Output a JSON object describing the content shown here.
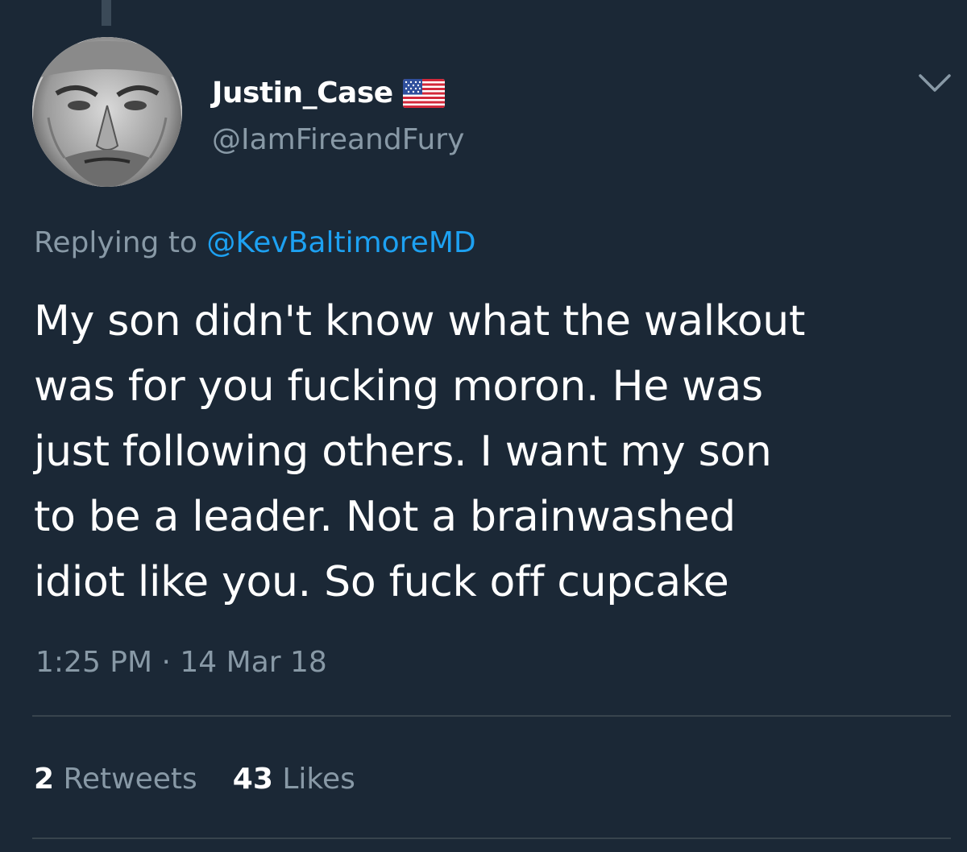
{
  "user": {
    "display_name": "Justin_Case",
    "handle": "@IamFireandFury",
    "avatar_icon": "user-avatar-photo",
    "flag_icon": "us-flag-emoji"
  },
  "reply": {
    "prefix": "Replying to",
    "mention": "@KevBaltimoreMD"
  },
  "tweet": {
    "lines": [
      "My son didn't know what the walkout",
      "was for you fucking moron. He was",
      "just following others. I want my son",
      "to be a leader. Not a brainwashed",
      "idiot like you. So fuck off cupcake"
    ]
  },
  "timestamp": "1:25 PM · 14 Mar 18",
  "stats": {
    "retweets_count": "2",
    "retweets_label": "Retweets",
    "likes_count": "43",
    "likes_label": "Likes"
  },
  "colors": {
    "background": "#1b2836",
    "text_primary": "#ffffff",
    "text_secondary": "#8899a6",
    "link": "#1da1f2",
    "divider": "#38444d"
  },
  "icons": {
    "menu": "chevron-down-icon"
  }
}
